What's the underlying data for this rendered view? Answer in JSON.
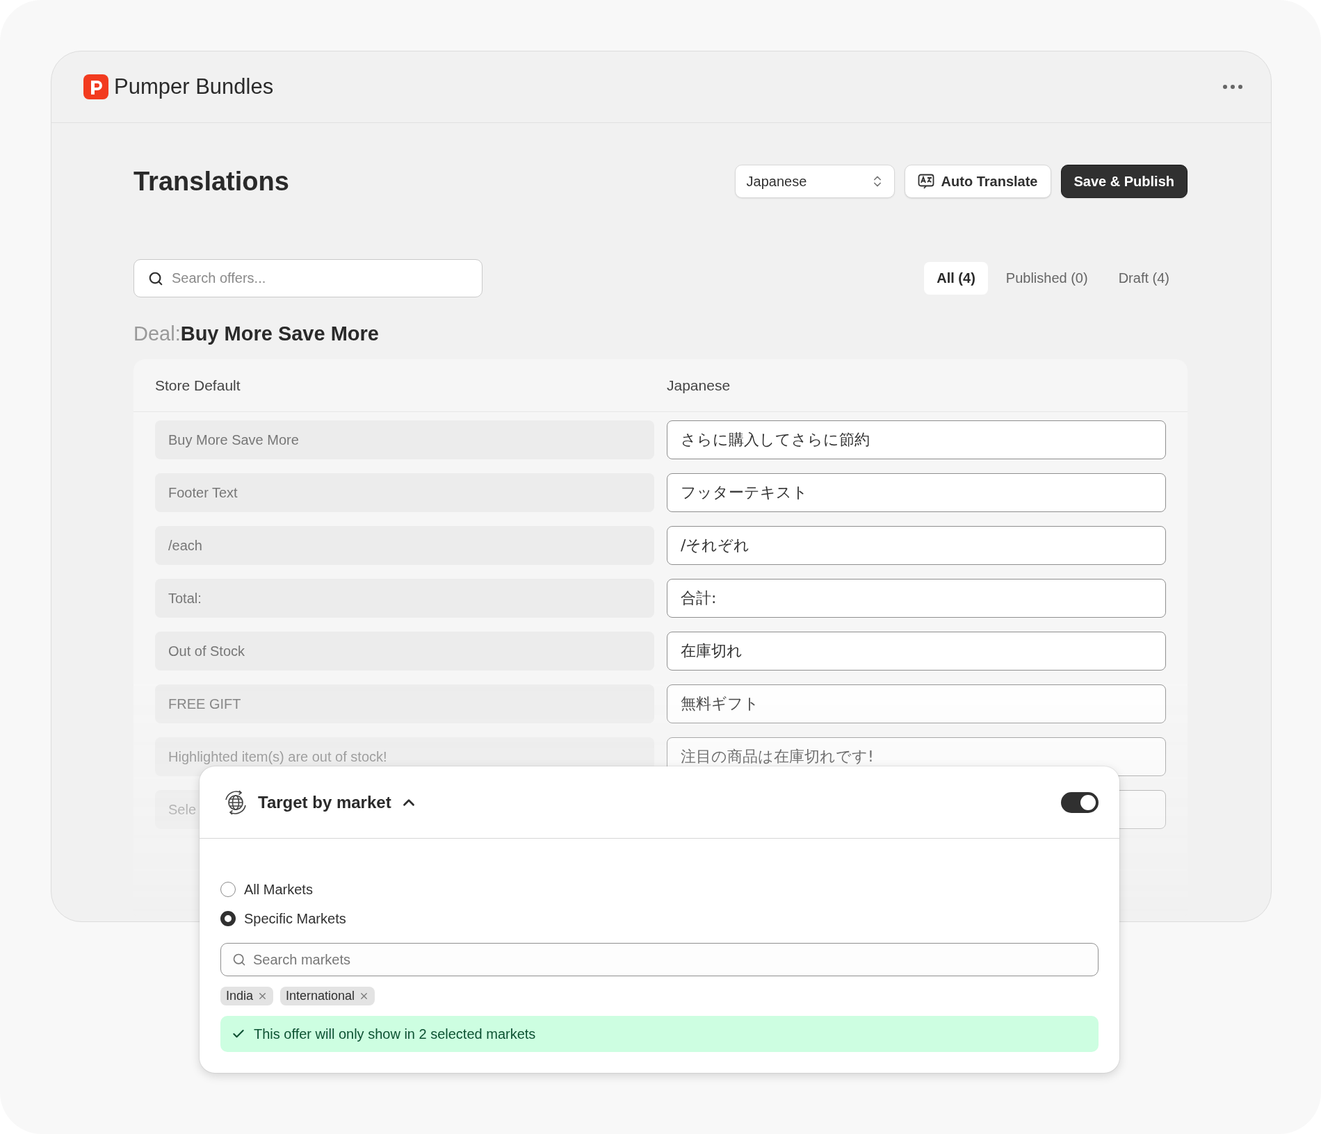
{
  "app": {
    "name": "Pumper Bundles"
  },
  "page": {
    "title": "Translations",
    "language_select": {
      "value": "Japanese"
    },
    "auto_translate": "Auto Translate",
    "publish": "Save & Publish"
  },
  "search": {
    "placeholder": "Search offers..."
  },
  "tabs": [
    {
      "label": "All (4)",
      "selected": true
    },
    {
      "label": "Published (0)",
      "selected": false
    },
    {
      "label": "Draft (4)",
      "selected": false
    }
  ],
  "deal": {
    "prefix": "Deal:",
    "name": "Buy More Save More"
  },
  "table": {
    "columns": [
      "Store Default",
      "Japanese"
    ],
    "rows": [
      {
        "source": "Buy More Save More",
        "translation": "さらに購入してさらに節約"
      },
      {
        "source": "Footer Text",
        "translation": "フッターテキスト"
      },
      {
        "source": "/each",
        "translation": "/それぞれ"
      },
      {
        "source": "Total:",
        "translation": "合計:"
      },
      {
        "source": "Out of Stock",
        "translation": "在庫切れ"
      },
      {
        "source": "FREE GIFT",
        "translation": "無料ギフト"
      },
      {
        "source": "Highlighted item(s) are out of stock!",
        "translation": "注目の商品は在庫切れです!"
      },
      {
        "source": "Sele"
      }
    ]
  },
  "market_panel": {
    "title": "Target by market",
    "expanded": true,
    "enabled": true,
    "options": [
      {
        "label": "All Markets",
        "selected": false
      },
      {
        "label": "Specific Markets",
        "selected": true
      }
    ],
    "search": {
      "placeholder": "Search markets"
    },
    "tags": [
      {
        "label": "India"
      },
      {
        "label": "International"
      }
    ],
    "notice": "This offer will only show in 2 selected markets"
  }
}
